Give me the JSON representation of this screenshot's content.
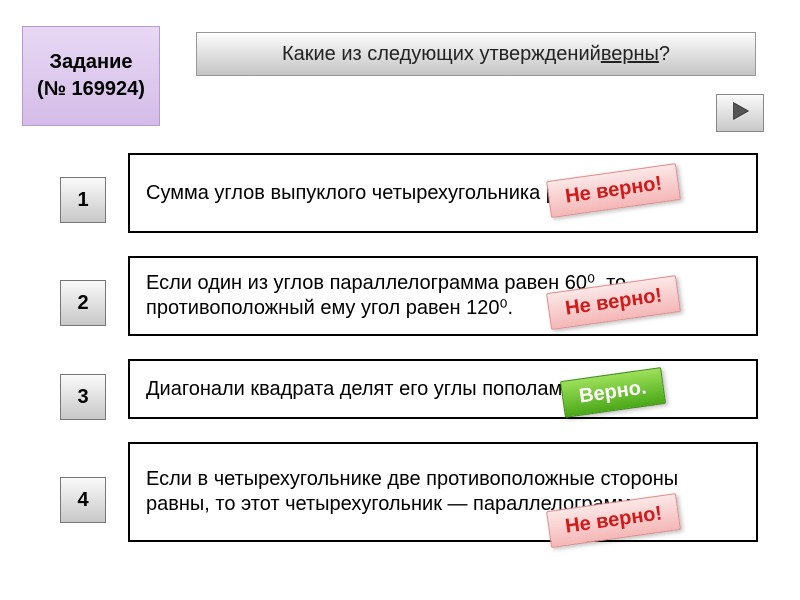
{
  "task": {
    "label": "Задание",
    "id_prefix": "(№ ",
    "id": "169924",
    "id_suffix": ")"
  },
  "question": {
    "prefix": "Какие из следующих утверждений ",
    "underlined": "верны",
    "suffix": "?"
  },
  "tags": {
    "wrong": "Не верно!",
    "right": "Верно."
  },
  "rows": [
    {
      "num": "1",
      "text": "Сумма углов выпуклого четырехугольника равна 180⁰.",
      "result": "wrong"
    },
    {
      "num": "2",
      "text": "Если один из углов параллелограмма равен 60⁰, то противоположный ему угол равен 120⁰.",
      "result": "wrong"
    },
    {
      "num": "3",
      "text": "Диагонали квадрата делят его углы пополам.",
      "result": "right"
    },
    {
      "num": "4",
      "text": "Если в четырехугольнике две противоположные стороны равны, то этот четырехугольник — параллелограмм.",
      "result": "wrong"
    }
  ]
}
